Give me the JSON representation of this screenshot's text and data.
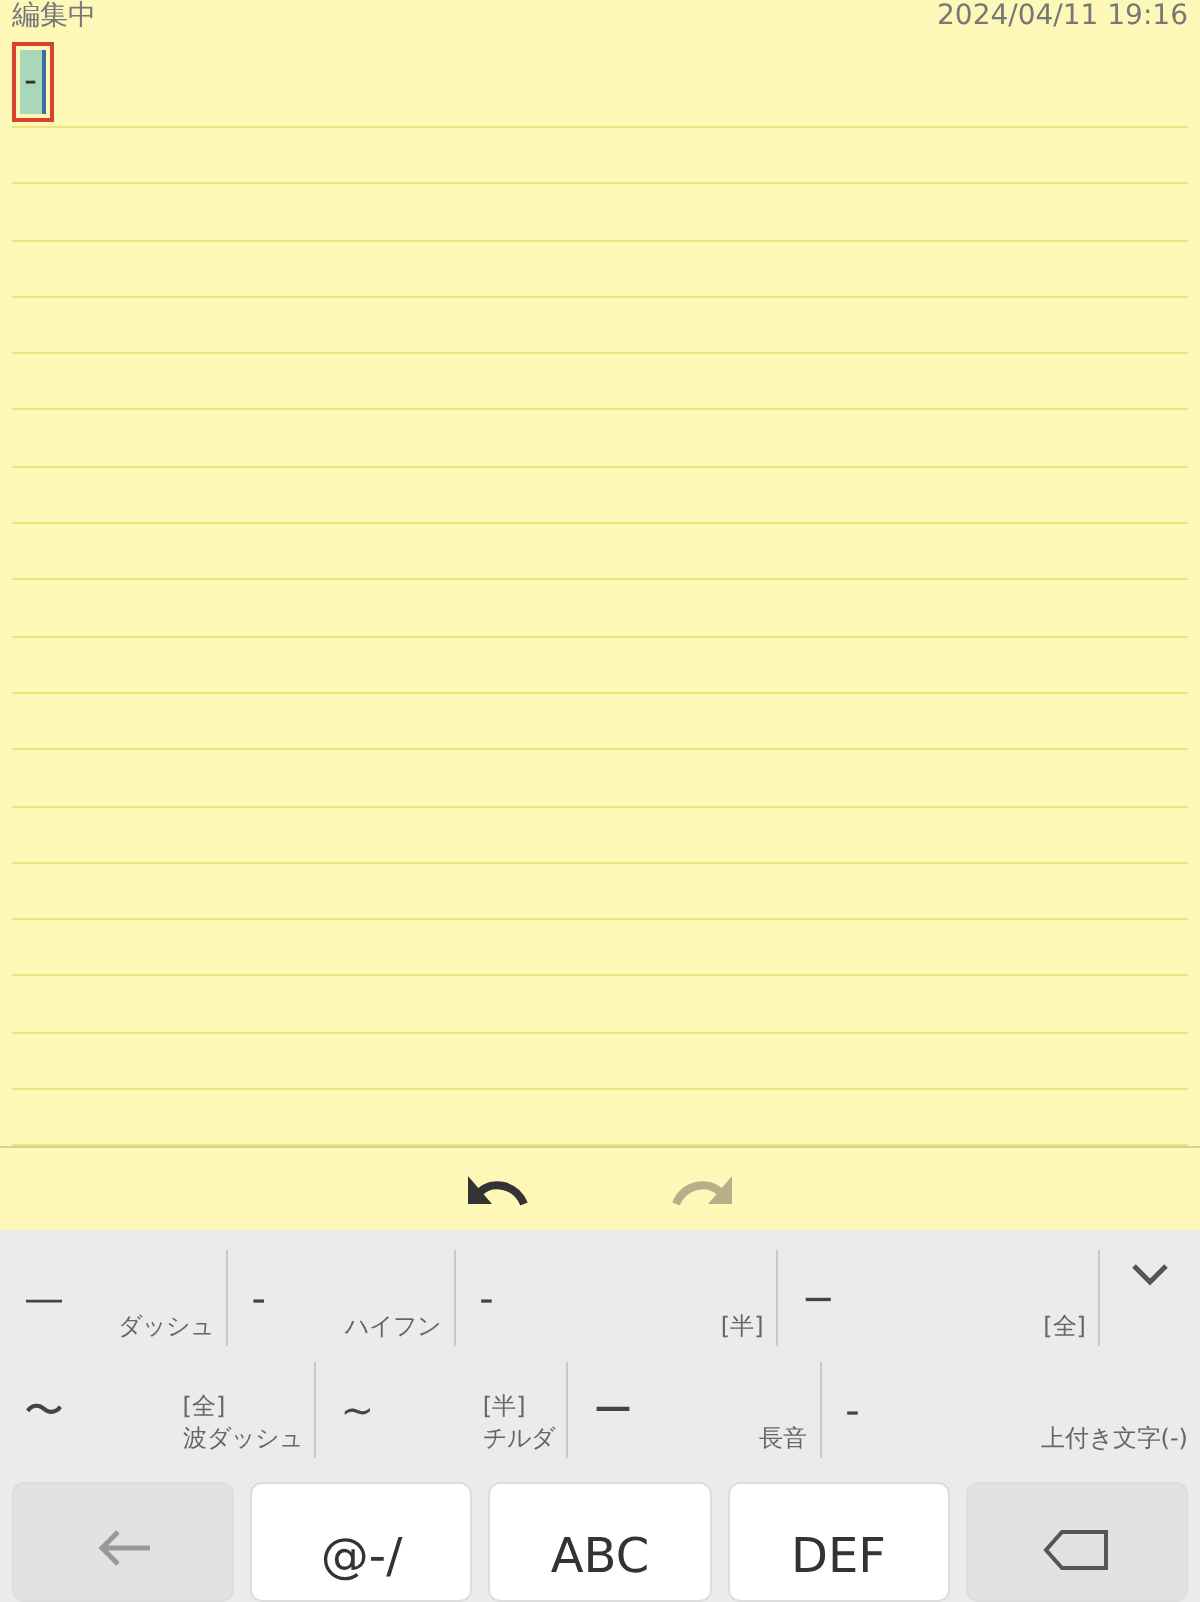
{
  "note": {
    "status": "編集中",
    "timestamp": "2024/04/11 19:16",
    "text": "-",
    "text_selected": true
  },
  "toolbar": {
    "undo": {
      "disabled": false
    },
    "redo": {
      "disabled": true
    }
  },
  "candidates": {
    "expanded": false,
    "rows": [
      [
        {
          "symbol": "—",
          "label": "ダッシュ"
        },
        {
          "symbol": "-",
          "label": "ハイフン"
        },
        {
          "symbol": "-",
          "label": "[半]"
        },
        {
          "symbol": "−",
          "label": "[全]"
        }
      ],
      [
        {
          "symbol": "〜",
          "label": "[全]\n波ダッシュ"
        },
        {
          "symbol": "~",
          "label": "[半]\nチルダ"
        },
        {
          "symbol": "ー",
          "label": "長音"
        },
        {
          "symbol": "-",
          "label": "上付き文字(-)"
        }
      ]
    ]
  },
  "keys": [
    {
      "kind": "back"
    },
    {
      "kind": "text",
      "label": "@-/"
    },
    {
      "kind": "text",
      "label": "ABC"
    },
    {
      "kind": "text",
      "label": "DEF"
    },
    {
      "kind": "delete"
    }
  ]
}
